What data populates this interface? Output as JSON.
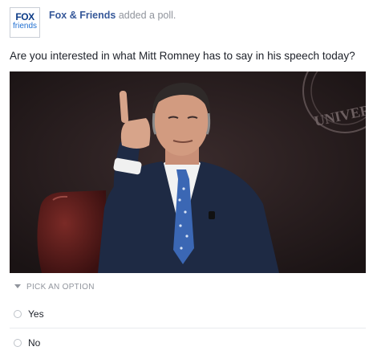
{
  "post": {
    "author": "Fox & Friends",
    "action": " added a poll.",
    "avatar": {
      "line1": "FOX",
      "line2": "friends"
    },
    "question": "Are you interested in what Mitt Romney has to say in his speech today?"
  },
  "photo": {
    "seal_text": "UNIVER"
  },
  "poll": {
    "pick_label": "PICK AN OPTION",
    "options": [
      {
        "label": "Yes"
      },
      {
        "label": "No"
      }
    ]
  },
  "colors": {
    "author_link": "#365899",
    "muted": "#90949c",
    "photo_background": "#241c1d"
  }
}
